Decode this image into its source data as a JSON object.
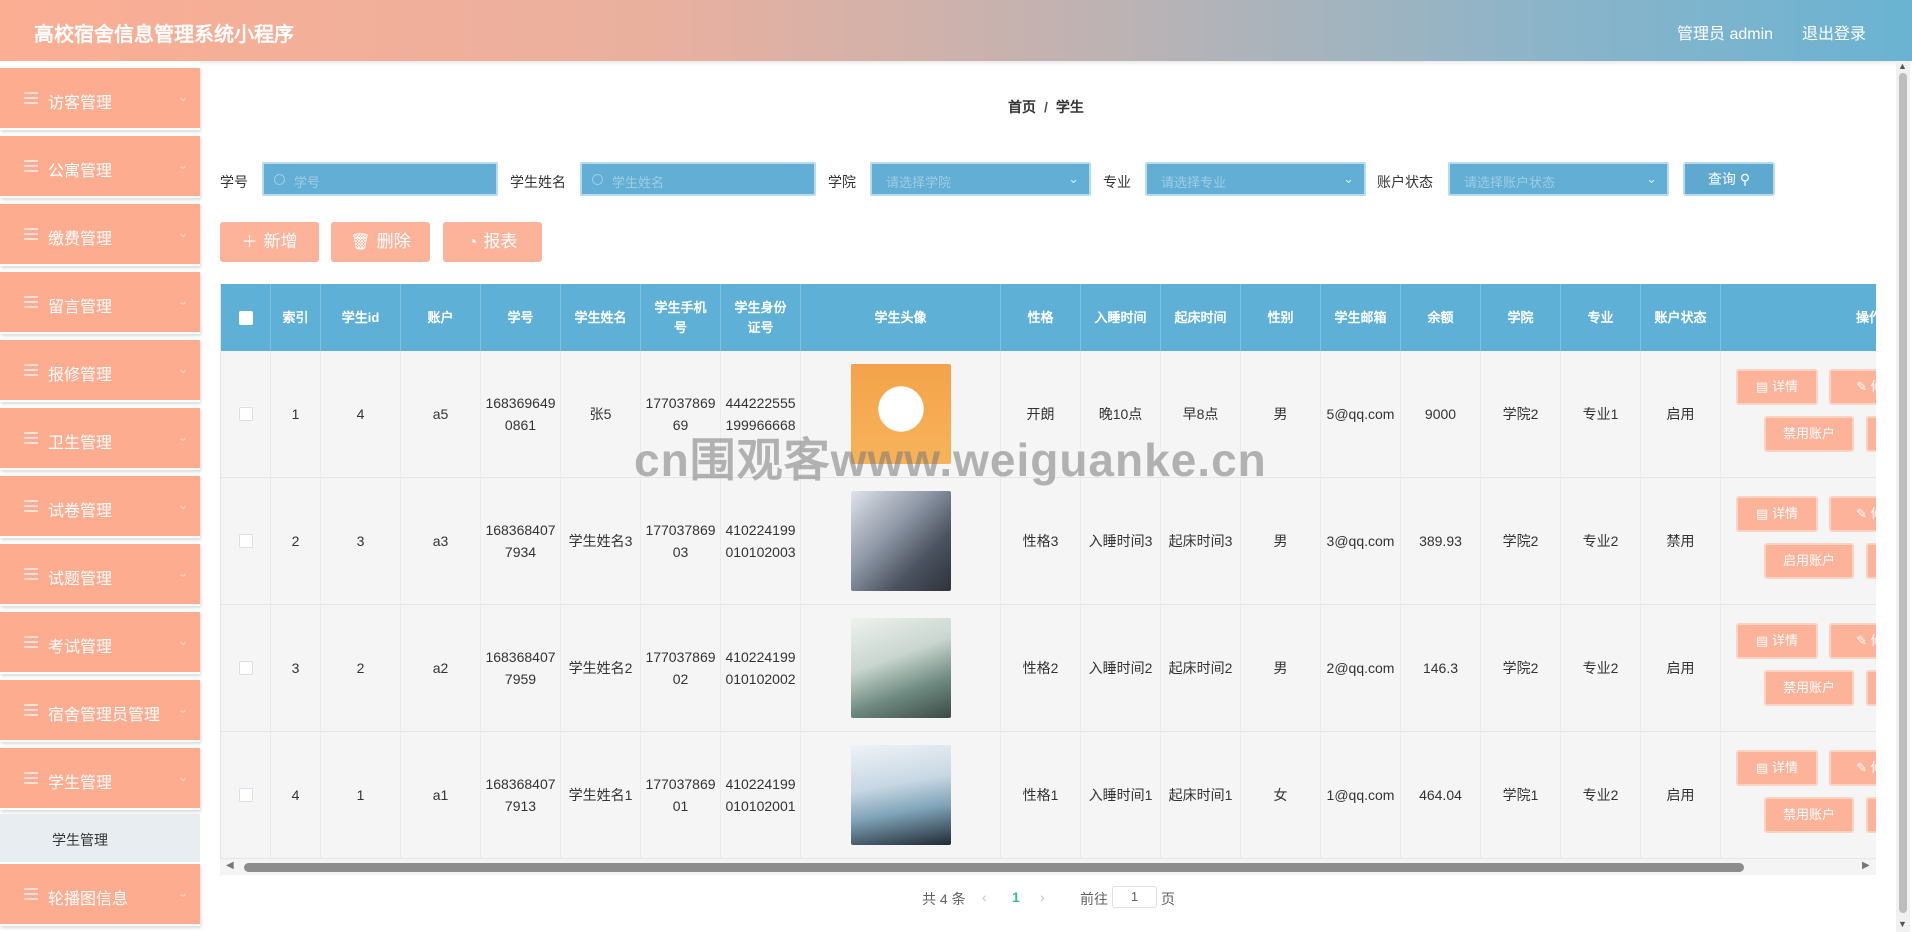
{
  "header": {
    "title": "高校宿舍信息管理系统小程序",
    "user": "管理员 admin",
    "logout": "退出登录"
  },
  "sidebar": {
    "items": [
      {
        "label": "访客管理",
        "icon": "menu-icon"
      },
      {
        "label": "公寓管理",
        "icon": "menu-icon"
      },
      {
        "label": "缴费管理",
        "icon": "menu-icon"
      },
      {
        "label": "留言管理",
        "icon": "menu-icon"
      },
      {
        "label": "报修管理",
        "icon": "menu-icon"
      },
      {
        "label": "卫生管理",
        "icon": "menu-icon"
      },
      {
        "label": "试卷管理",
        "icon": "menu-icon"
      },
      {
        "label": "试题管理",
        "icon": "menu-icon"
      },
      {
        "label": "考试管理",
        "icon": "menu-icon"
      },
      {
        "label": "宿舍管理员管理",
        "icon": "menu-icon"
      },
      {
        "label": "学生管理",
        "icon": "menu-icon"
      }
    ],
    "submenu": "学生管理",
    "last_item": "轮播图信息"
  },
  "breadcrumb": {
    "home": "首页",
    "sep": "/",
    "current": "学生"
  },
  "filters": {
    "xuehao_label": "学号",
    "xuehao_ph": "学号",
    "name_label": "学生姓名",
    "name_ph": "学生姓名",
    "college_label": "学院",
    "college_ph": "请选择学院",
    "major_label": "专业",
    "major_ph": "请选择专业",
    "status_label": "账户状态",
    "status_ph": "请选择账户状态",
    "query": "查询"
  },
  "actions": {
    "add": "新增",
    "delete": "删除",
    "report": "报表"
  },
  "table": {
    "headers": [
      "索引",
      "学生id",
      "账户",
      "学号",
      "学生姓名",
      "学生手机号",
      "学生身份证号",
      "学生头像",
      "性格",
      "入睡时间",
      "起床时间",
      "性别",
      "学生邮箱",
      "余额",
      "学院",
      "专业",
      "账户状态",
      "操作"
    ],
    "rows": [
      {
        "idx": "1",
        "sid": "4",
        "account": "a5",
        "xuehao": "1683696490861",
        "name": "张5",
        "phone": "17703786969",
        "idcard": "444222555199966668",
        "personality": "开朗",
        "sleep": "晚10点",
        "wake": "早8点",
        "gender": "男",
        "email": "5@qq.com",
        "balance": "9000",
        "college": "学院2",
        "major": "专业1",
        "status": "启用",
        "toggle": "禁用账户"
      },
      {
        "idx": "2",
        "sid": "3",
        "account": "a3",
        "xuehao": "1683684077934",
        "name": "学生姓名3",
        "phone": "17703786903",
        "idcard": "410224199010102003",
        "personality": "性格3",
        "sleep": "入睡时间3",
        "wake": "起床时间3",
        "gender": "男",
        "email": "3@qq.com",
        "balance": "389.93",
        "college": "学院2",
        "major": "专业2",
        "status": "禁用",
        "toggle": "启用账户"
      },
      {
        "idx": "3",
        "sid": "2",
        "account": "a2",
        "xuehao": "1683684077959",
        "name": "学生姓名2",
        "phone": "17703786902",
        "idcard": "410224199010102002",
        "personality": "性格2",
        "sleep": "入睡时间2",
        "wake": "起床时间2",
        "gender": "男",
        "email": "2@qq.com",
        "balance": "146.3",
        "college": "学院2",
        "major": "专业2",
        "status": "启用",
        "toggle": "禁用账户"
      },
      {
        "idx": "4",
        "sid": "1",
        "account": "a1",
        "xuehao": "1683684077913",
        "name": "学生姓名1",
        "phone": "17703786901",
        "idcard": "410224199010102001",
        "personality": "性格1",
        "sleep": "入睡时间1",
        "wake": "起床时间1",
        "gender": "女",
        "email": "1@qq.com",
        "balance": "464.04",
        "college": "学院1",
        "major": "专业2",
        "status": "启用",
        "toggle": "禁用账户"
      }
    ],
    "detail": "详情",
    "edit": "修"
  },
  "pager": {
    "total": "共 4 条",
    "current": "1",
    "goto": "前往",
    "page_value": "1",
    "unit": "页"
  },
  "watermark": "cn围观客www.weiguanke.cn",
  "colors": {
    "accent": "#fdac90",
    "header_table": "#5fb0d6"
  }
}
